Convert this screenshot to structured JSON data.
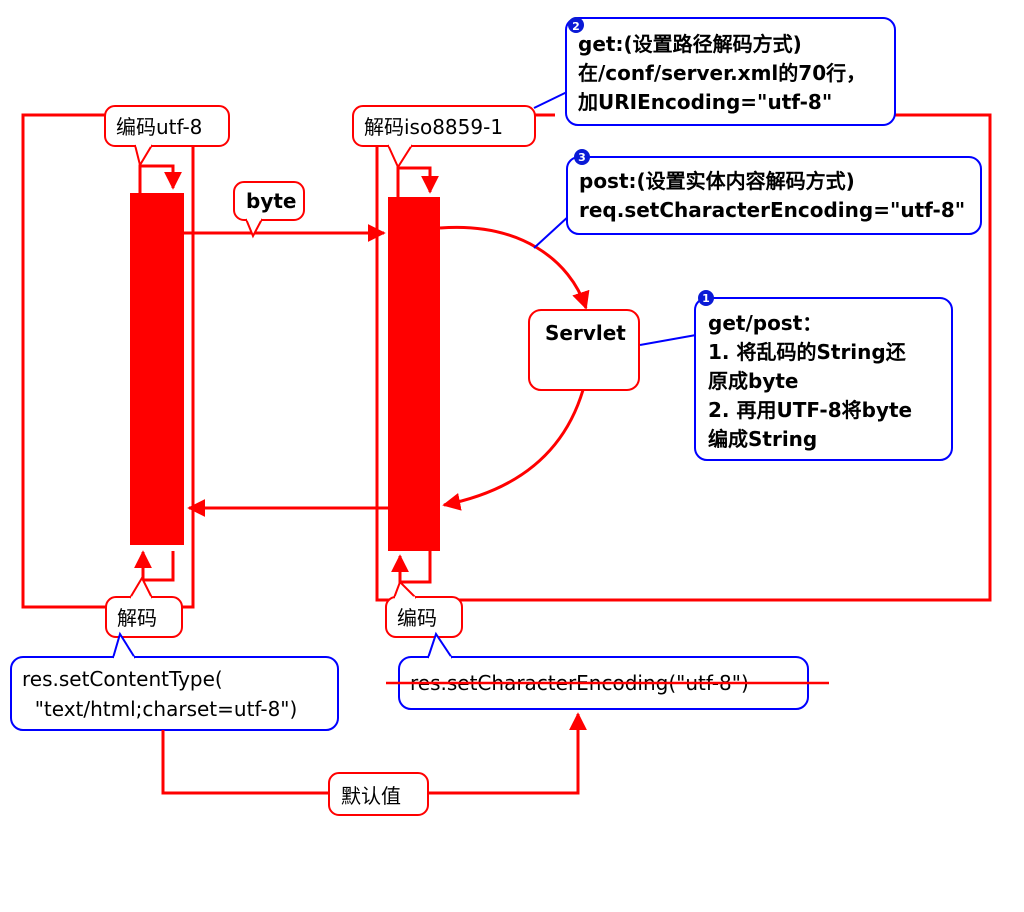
{
  "colors": {
    "red": "#ff0000",
    "blue": "#0000ff",
    "badge_fill": "#0a1ad6",
    "text": "#000000",
    "background": "#ffffff"
  },
  "callouts": {
    "encode_utf8": "编码utf-8",
    "decode_iso": "解码iso8859-1",
    "byte": "byte",
    "decode_left": "解码",
    "encode_right": "编码",
    "default_value": "默认值"
  },
  "servlet_label": "Servlet",
  "notes": {
    "get": {
      "badge": "2",
      "lines": [
        "get:(设置路径解码方式)",
        "在/conf/server.xml的70行，",
        "加URIEncoding=\"utf-8\""
      ]
    },
    "post": {
      "badge": "3",
      "lines": [
        "post:(设置实体内容解码方式)",
        "req.setCharacterEncoding=\"utf-8\""
      ]
    },
    "getpost": {
      "badge": "1",
      "lines": [
        "get/post：",
        "1. 将乱码的String还",
        "原成byte",
        "2. 再用UTF-8将byte",
        "编成String"
      ]
    },
    "res_content_type": {
      "lines": [
        "res.setContentType(",
        "  \"text/html;charset=utf-8\")"
      ]
    },
    "res_char_encoding": {
      "lines": [
        "res.setCharacterEncoding(\"utf-8\")"
      ],
      "struck_through": true
    }
  }
}
